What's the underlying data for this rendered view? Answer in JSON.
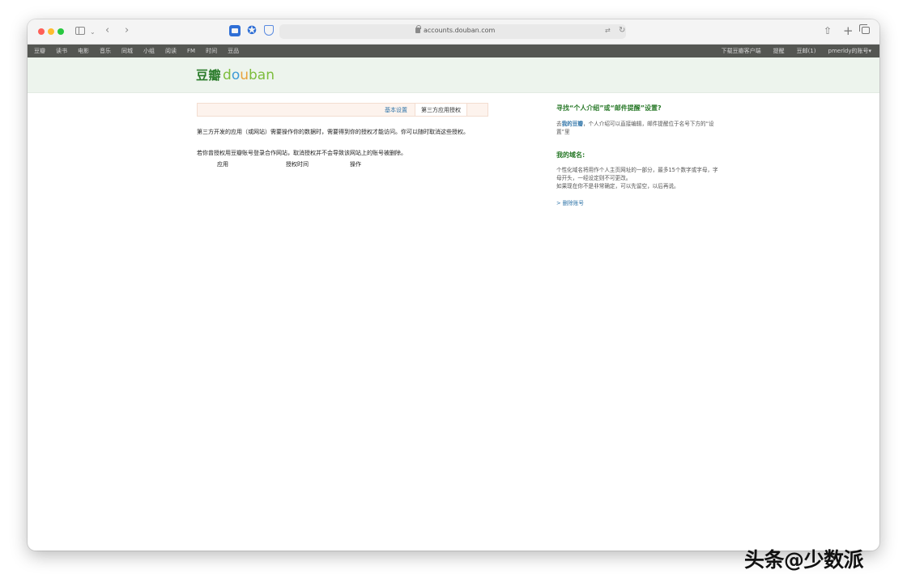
{
  "browser": {
    "url": "accounts.douban.com"
  },
  "global_nav": {
    "left_items": [
      "豆瓣",
      "读书",
      "电影",
      "音乐",
      "同城",
      "小组",
      "阅读",
      "FM",
      "时间",
      "豆品"
    ],
    "right_items": [
      "下载豆瓣客户端",
      "提醒",
      "豆邮(1)",
      "pmerldy的账号▾"
    ]
  },
  "header": {
    "logo_cn": "豆瓣",
    "logo_en_parts": [
      "d",
      "o",
      "u",
      "ba",
      "n"
    ]
  },
  "tabs": {
    "basic": "基本设置",
    "third_party": "第三方应用授权"
  },
  "content": {
    "description": "第三方开发的应用（或网站）需要操作你的数据时，需要得到你的授权才能访问。你可以随时取消这些授权。",
    "note": "若你曾授权用豆瓣账号登录合作网站，取消授权并不会导致该网站上的账号被删除。",
    "columns": {
      "app": "应用",
      "time": "授权时间",
      "action": "操作"
    }
  },
  "sidebar": {
    "title1": "寻找“个人介绍”或“邮件提醒”设置?",
    "p1_prefix": "去",
    "p1_link": "我的豆瓣",
    "p1_suffix": "，个人介绍可以直接编辑，邮件提醒位于名号下方的“设置”里",
    "title2": "我的域名:",
    "p2_line1": "个性化域名将用作个人主页网址的一部分，最多15个数字或字母，字母开头，一经设定则不可更改。",
    "p2_line2": "如果现在你不是非常确定，可以先留空，以后再说。",
    "delete_link": "> 删除账号"
  },
  "watermark": "头条@少数派"
}
